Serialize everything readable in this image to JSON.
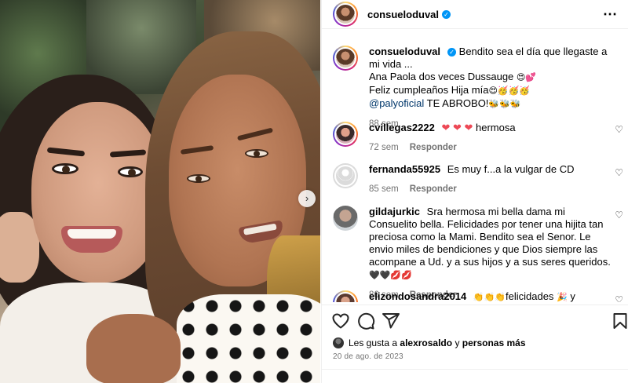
{
  "post": {
    "author": "consueloduval",
    "caption_line1": "Bendito sea el día que llegaste a mi vida ...",
    "caption_line2": "Ana Paola dos veces Dussauge",
    "caption_line3": "Feliz cumpleaños Hija mía",
    "caption_mention": "@palyoficial",
    "caption_tail": "TE ABROBO!",
    "emoji_line2": "😍💕",
    "emoji_line3": "😍🥳🥳🥳",
    "emoji_tail": "🐝🐝🐝",
    "age": "88 sem"
  },
  "comments": [
    {
      "user": "cvillegas2222",
      "text": "hermosa",
      "hearts": "❤ ❤ ❤",
      "age": "72 sem",
      "reply": "Responder"
    },
    {
      "user": "fernanda55925",
      "text": "Es muy f...a la vulgar de CD",
      "age": "85 sem",
      "reply": "Responder"
    },
    {
      "user": "gildajurkic",
      "text": "Sra hermosa mi bella dama mi Consuelito bella. Felicidades por tener una hijita tan preciosa como la Mami. Bendito sea el Senor. Le envio miles de bendiciones y que Dios siempre las acompane a Ud. y a sus hijos y a sus seres queridos.",
      "emoji": "🖤🖤💋💋",
      "age": "86 sem",
      "reply": "Responder"
    },
    {
      "user": "elizondosandra2014",
      "text": "felicidades",
      "emoji_pre": "👏👏👏",
      "emoji_post": "🎉",
      "text2": "y bendiciones"
    }
  ],
  "likes": {
    "prefix": "Les gusta a",
    "user": "alexrosaldo",
    "conj": "y",
    "others": "personas más"
  },
  "date": "20 de ago. de 2023",
  "icons": {
    "more": "⋯",
    "carousel_next": "›",
    "heart_small": "♡"
  },
  "colors": {
    "link": "#00376b",
    "verified": "#0095f6",
    "meta": "#737373"
  }
}
